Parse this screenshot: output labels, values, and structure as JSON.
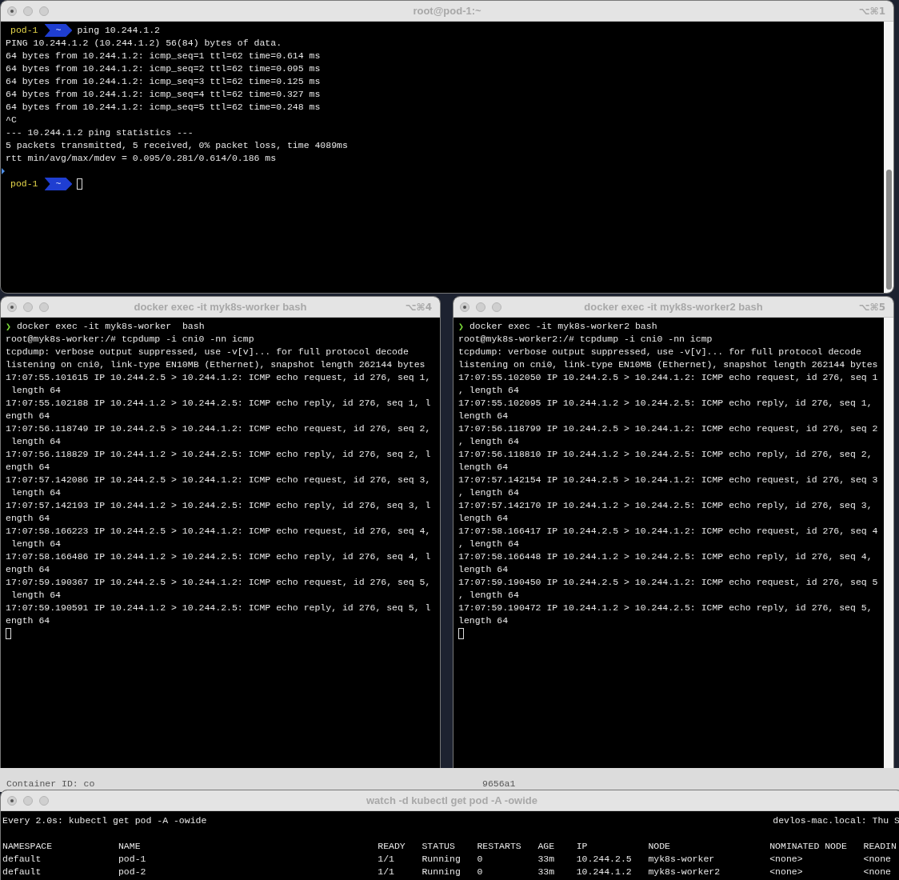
{
  "terminals": [
    {
      "title": "root@pod-1:~",
      "shortcut": "⌥⌘1",
      "lines": [
        {
          "kind": "prompt",
          "host": "pod-1",
          "dir": "~",
          "command": "ping 10.244.1.2",
          "cursor": false
        },
        {
          "kind": "output",
          "text": "PING 10.244.1.2 (10.244.1.2) 56(84) bytes of data."
        },
        {
          "kind": "output",
          "text": "64 bytes from 10.244.1.2: icmp_seq=1 ttl=62 time=0.614 ms"
        },
        {
          "kind": "output",
          "text": "64 bytes from 10.244.1.2: icmp_seq=2 ttl=62 time=0.095 ms"
        },
        {
          "kind": "output",
          "text": "64 bytes from 10.244.1.2: icmp_seq=3 ttl=62 time=0.125 ms"
        },
        {
          "kind": "output",
          "text": "64 bytes from 10.244.1.2: icmp_seq=4 ttl=62 time=0.327 ms"
        },
        {
          "kind": "output",
          "text": "64 bytes from 10.244.1.2: icmp_seq=5 ttl=62 time=0.248 ms"
        },
        {
          "kind": "output",
          "text": "^C"
        },
        {
          "kind": "output",
          "text": "--- 10.244.1.2 ping statistics ---"
        },
        {
          "kind": "output",
          "text": "5 packets transmitted, 5 received, 0% packet loss, time 4089ms"
        },
        {
          "kind": "output",
          "text": "rtt min/avg/max/mdev = 0.095/0.281/0.614/0.186 ms"
        },
        {
          "kind": "mark"
        },
        {
          "kind": "prompt",
          "host": "pod-1",
          "dir": "~",
          "cursor": true
        }
      ]
    },
    {
      "title": "docker exec -it myk8s-worker bash",
      "shortcut": "⌥⌘4",
      "lines": [
        {
          "kind": "command",
          "marker": "❯",
          "text": "docker exec -it myk8s-worker  bash"
        },
        {
          "kind": "output",
          "text": "root@myk8s-worker:/# tcpdump -i cni0 -nn icmp"
        },
        {
          "kind": "output",
          "text": "tcpdump: verbose output suppressed, use -v[v]... for full protocol decode"
        },
        {
          "kind": "output",
          "text": "listening on cni0, link-type EN10MB (Ethernet), snapshot length 262144 bytes"
        },
        {
          "kind": "output",
          "text": "17:07:55.101615 IP 10.244.2.5 > 10.244.1.2: ICMP echo request, id 276, seq 1,"
        },
        {
          "kind": "output",
          "text": " length 64"
        },
        {
          "kind": "output",
          "text": "17:07:55.102188 IP 10.244.1.2 > 10.244.2.5: ICMP echo reply, id 276, seq 1, l"
        },
        {
          "kind": "output",
          "text": "ength 64"
        },
        {
          "kind": "output",
          "text": "17:07:56.118749 IP 10.244.2.5 > 10.244.1.2: ICMP echo request, id 276, seq 2,"
        },
        {
          "kind": "output",
          "text": " length 64"
        },
        {
          "kind": "output",
          "text": "17:07:56.118829 IP 10.244.1.2 > 10.244.2.5: ICMP echo reply, id 276, seq 2, l"
        },
        {
          "kind": "output",
          "text": "ength 64"
        },
        {
          "kind": "output",
          "text": "17:07:57.142086 IP 10.244.2.5 > 10.244.1.2: ICMP echo request, id 276, seq 3,"
        },
        {
          "kind": "output",
          "text": " length 64"
        },
        {
          "kind": "output",
          "text": "17:07:57.142193 IP 10.244.1.2 > 10.244.2.5: ICMP echo reply, id 276, seq 3, l"
        },
        {
          "kind": "output",
          "text": "ength 64"
        },
        {
          "kind": "output",
          "text": "17:07:58.166223 IP 10.244.2.5 > 10.244.1.2: ICMP echo request, id 276, seq 4,"
        },
        {
          "kind": "output",
          "text": " length 64"
        },
        {
          "kind": "output",
          "text": "17:07:58.166486 IP 10.244.1.2 > 10.244.2.5: ICMP echo reply, id 276, seq 4, l"
        },
        {
          "kind": "output",
          "text": "ength 64"
        },
        {
          "kind": "output",
          "text": "17:07:59.190367 IP 10.244.2.5 > 10.244.1.2: ICMP echo request, id 276, seq 5,"
        },
        {
          "kind": "output",
          "text": " length 64"
        },
        {
          "kind": "output",
          "text": "17:07:59.190591 IP 10.244.1.2 > 10.244.2.5: ICMP echo reply, id 276, seq 5, l"
        },
        {
          "kind": "output",
          "text": "ength 64"
        },
        {
          "kind": "cursor"
        }
      ]
    },
    {
      "title": "docker exec -it myk8s-worker2 bash",
      "shortcut": "⌥⌘5",
      "lines": [
        {
          "kind": "command",
          "marker": "❯",
          "text": "docker exec -it myk8s-worker2 bash"
        },
        {
          "kind": "output",
          "text": "root@myk8s-worker2:/# tcpdump -i cni0 -nn icmp"
        },
        {
          "kind": "output",
          "text": "tcpdump: verbose output suppressed, use -v[v]... for full protocol decode"
        },
        {
          "kind": "output",
          "text": "listening on cni0, link-type EN10MB (Ethernet), snapshot length 262144 bytes"
        },
        {
          "kind": "output",
          "text": "17:07:55.102050 IP 10.244.2.5 > 10.244.1.2: ICMP echo request, id 276, seq 1"
        },
        {
          "kind": "output",
          "text": ", length 64"
        },
        {
          "kind": "output",
          "text": "17:07:55.102095 IP 10.244.1.2 > 10.244.2.5: ICMP echo reply, id 276, seq 1,"
        },
        {
          "kind": "output",
          "text": "length 64"
        },
        {
          "kind": "output",
          "text": "17:07:56.118799 IP 10.244.2.5 > 10.244.1.2: ICMP echo request, id 276, seq 2"
        },
        {
          "kind": "output",
          "text": ", length 64"
        },
        {
          "kind": "output",
          "text": "17:07:56.118810 IP 10.244.1.2 > 10.244.2.5: ICMP echo reply, id 276, seq 2,"
        },
        {
          "kind": "output",
          "text": "length 64"
        },
        {
          "kind": "output",
          "text": "17:07:57.142154 IP 10.244.2.5 > 10.244.1.2: ICMP echo request, id 276, seq 3"
        },
        {
          "kind": "output",
          "text": ", length 64"
        },
        {
          "kind": "output",
          "text": "17:07:57.142170 IP 10.244.1.2 > 10.244.2.5: ICMP echo reply, id 276, seq 3,"
        },
        {
          "kind": "output",
          "text": "length 64"
        },
        {
          "kind": "output",
          "text": "17:07:58.166417 IP 10.244.2.5 > 10.244.1.2: ICMP echo request, id 276, seq 4"
        },
        {
          "kind": "output",
          "text": ", length 64"
        },
        {
          "kind": "output",
          "text": "17:07:58.166448 IP 10.244.1.2 > 10.244.2.5: ICMP echo reply, id 276, seq 4,"
        },
        {
          "kind": "output",
          "text": "length 64"
        },
        {
          "kind": "output",
          "text": "17:07:59.190450 IP 10.244.2.5 > 10.244.1.2: ICMP echo request, id 276, seq 5"
        },
        {
          "kind": "output",
          "text": ", length 64"
        },
        {
          "kind": "output",
          "text": "17:07:59.190472 IP 10.244.1.2 > 10.244.2.5: ICMP echo reply, id 276, seq 5,"
        },
        {
          "kind": "output",
          "text": "length 64"
        },
        {
          "kind": "cursor"
        }
      ]
    }
  ],
  "background_window": {
    "texts": [
      "Container ID: co",
      "9656a1"
    ]
  },
  "watch_window": {
    "title": "watch -d kubectl get pod -A -owide",
    "header_left": "Every 2.0s: kubectl get pod -A -owide",
    "header_right": "devlos-mac.local: Thu S",
    "columns": [
      "NAMESPACE",
      "NAME",
      "READY",
      "STATUS",
      "RESTARTS",
      "AGE",
      "IP",
      "NODE",
      "NOMINATED NODE",
      "READIN"
    ],
    "rows": [
      [
        "default",
        "pod-1",
        "1/1",
        "Running",
        "0",
        "33m",
        "10.244.2.5",
        "myk8s-worker",
        "<none>",
        "<none"
      ],
      [
        "default",
        "pod-2",
        "1/1",
        "Running",
        "0",
        "33m",
        "10.244.1.2",
        "myk8s-worker2",
        "<none>",
        "<none"
      ]
    ]
  }
}
